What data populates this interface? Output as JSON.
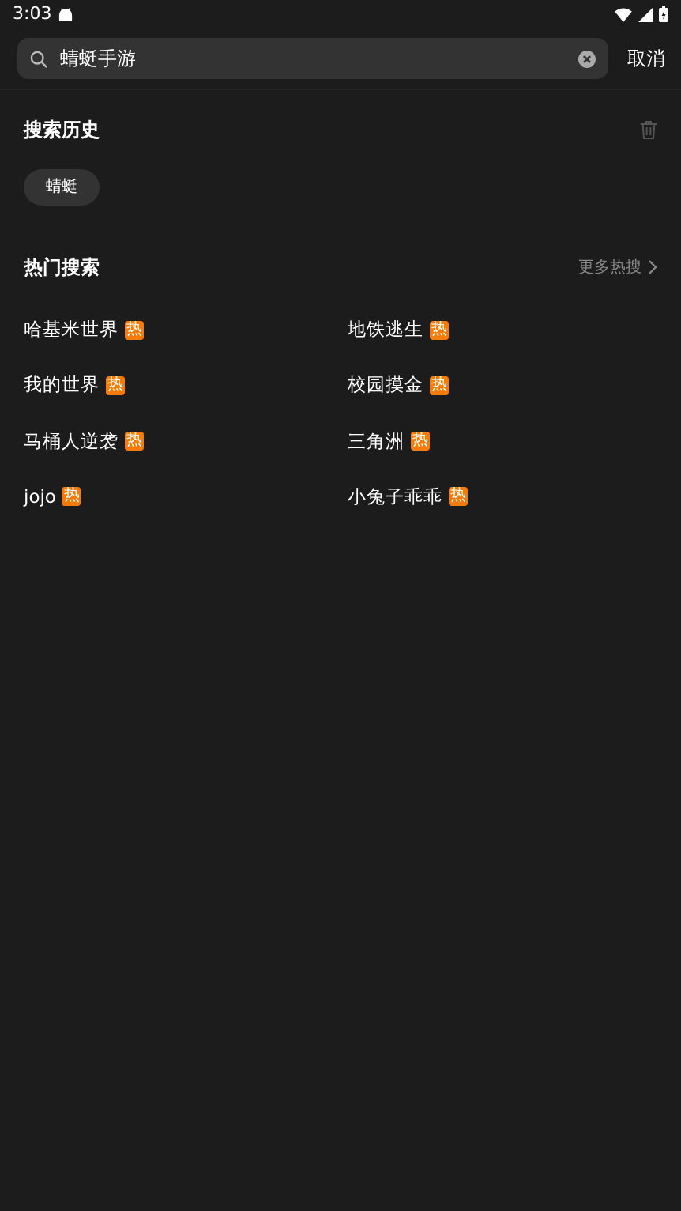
{
  "status_bar": {
    "time": "3:03"
  },
  "search": {
    "value": "蜻蜓手游",
    "cancel": "取消"
  },
  "history": {
    "title": "搜索历史",
    "items": [
      "蜻蜓"
    ]
  },
  "hot": {
    "title": "热门搜索",
    "more": "更多热搜",
    "items": [
      {
        "label": "哈基米世界",
        "badge": "热"
      },
      {
        "label": "地铁逃生",
        "badge": "热"
      },
      {
        "label": "我的世界",
        "badge": "热"
      },
      {
        "label": "校园摸金",
        "badge": "热"
      },
      {
        "label": "马桶人逆袭",
        "badge": "热"
      },
      {
        "label": "三角洲",
        "badge": "热"
      },
      {
        "label": "jojo",
        "badge": "热"
      },
      {
        "label": "小兔子乖乖",
        "badge": "热"
      }
    ]
  }
}
